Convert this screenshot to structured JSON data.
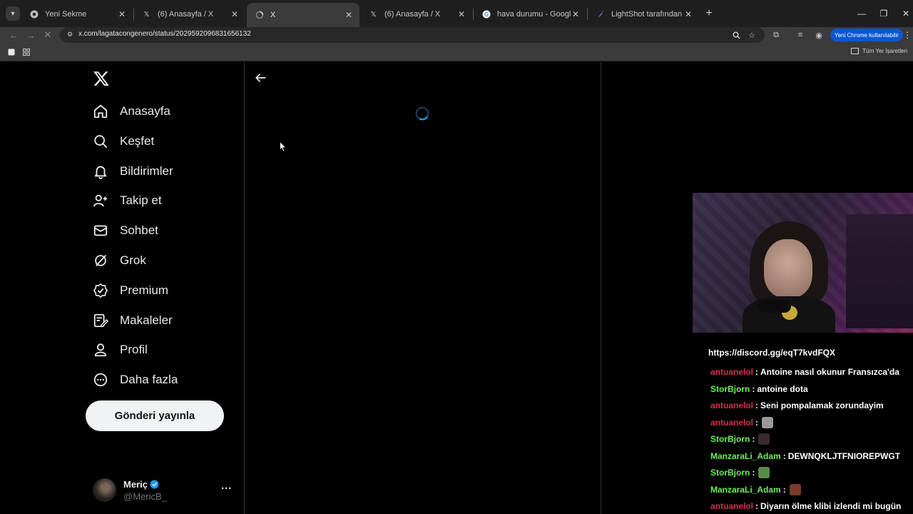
{
  "browser": {
    "tabs": [
      {
        "title": "Yeni Sekme",
        "favicon": "chrome-icon",
        "active": false
      },
      {
        "title": "(6) Anasayfa / X",
        "favicon": "x-icon",
        "active": false
      },
      {
        "title": "X",
        "favicon": "loading-icon",
        "active": true
      },
      {
        "title": "(6) Anasayfa / X",
        "favicon": "x-icon",
        "active": false
      },
      {
        "title": "hava durumu - Google'da Ara",
        "favicon": "google-icon",
        "active": false
      },
      {
        "title": "LightShot tarafından Ekran Görü",
        "favicon": "lightshot-icon",
        "active": false
      }
    ],
    "url": "x.com/lagatacongenero/status/2029592096831656132",
    "update_button": "Yeni Chrome kullanılabilir",
    "all_bookmarks": "Tüm Yer İşaretleri"
  },
  "sidebar": {
    "items": [
      {
        "label": "Anasayfa",
        "icon": "home-icon"
      },
      {
        "label": "Keşfet",
        "icon": "search-icon"
      },
      {
        "label": "Bildirimler",
        "icon": "bell-icon"
      },
      {
        "label": "Takip et",
        "icon": "follow-icon"
      },
      {
        "label": "Sohbet",
        "icon": "mail-icon"
      },
      {
        "label": "Grok",
        "icon": "grok-icon"
      },
      {
        "label": "Premium",
        "icon": "premium-icon"
      },
      {
        "label": "Makaleler",
        "icon": "articles-icon"
      },
      {
        "label": "Profil",
        "icon": "profile-icon"
      },
      {
        "label": "Daha fazla",
        "icon": "more-circle-icon"
      }
    ],
    "post_button": "Gönderi yayınla",
    "account": {
      "name": "Meriç",
      "handle": "@MericB_",
      "more": "···"
    }
  },
  "chat": {
    "link": "https://discord.gg/eqT7kvdFQX",
    "colors": {
      "antuanelol": "#d6304f",
      "StorBjorn": "#6df05a",
      "ManzaraLi_Adam": "#6df05a"
    },
    "messages": [
      {
        "user": "antuanelol",
        "text": "Antoine nasıl okunur Fransızca'da",
        "emote": ""
      },
      {
        "user": "StorBjorn",
        "text": "antoine dota",
        "emote": ""
      },
      {
        "user": "antuanelol",
        "text": "Seni pompalamak zorundayim",
        "emote": ""
      },
      {
        "user": "antuanelol",
        "text": "",
        "emote": "face-emote"
      },
      {
        "user": "StorBjorn",
        "text": "",
        "emote": "dark-emote"
      },
      {
        "user": "ManzaraLi_Adam",
        "text": "DEWNQKLJTFNIOREPWGT",
        "emote": ""
      },
      {
        "user": "StorBjorn",
        "text": "",
        "emote": "green-emote"
      },
      {
        "user": "ManzaraLi_Adam",
        "text": "",
        "emote": "red-emote"
      },
      {
        "user": "antuanelol",
        "text": "Diyarın ölme klibi izlendi mi bugün",
        "emote": ""
      }
    ]
  }
}
